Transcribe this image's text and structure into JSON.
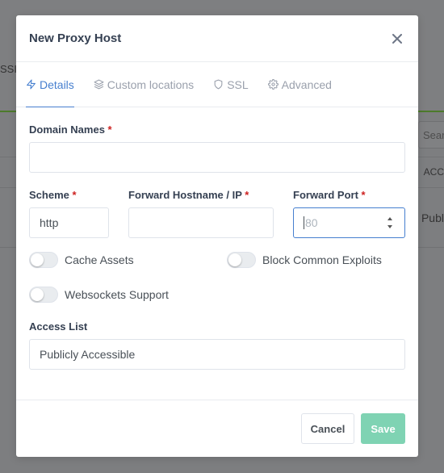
{
  "background": {
    "left_fragment": "SSI",
    "search_fragment": "Searc",
    "col_fragment": "ACC",
    "cell_fragment": "Publ"
  },
  "modal": {
    "title": "New Proxy Host",
    "close_icon": "close-icon"
  },
  "tabs": [
    {
      "label": "Details",
      "icon": "bolt-icon",
      "active": true
    },
    {
      "label": "Custom locations",
      "icon": "layers-icon",
      "active": false
    },
    {
      "label": "SSL",
      "icon": "shield-icon",
      "active": false
    },
    {
      "label": "Advanced",
      "icon": "gear-icon",
      "active": false
    }
  ],
  "form": {
    "domain_names": {
      "label": "Domain Names",
      "required_mark": "*",
      "value": ""
    },
    "scheme": {
      "label": "Scheme",
      "required_mark": "*",
      "value": "http"
    },
    "forward_hostname": {
      "label": "Forward Hostname / IP",
      "required_mark": "*",
      "value": ""
    },
    "forward_port": {
      "label": "Forward Port",
      "required_mark": "*",
      "placeholder": "80",
      "value": ""
    },
    "toggles": {
      "cache_assets": "Cache Assets",
      "block_exploits": "Block Common Exploits",
      "websockets": "Websockets Support"
    },
    "access_list": {
      "label": "Access List",
      "value": "Publicly Accessible"
    }
  },
  "footer": {
    "cancel_label": "Cancel",
    "save_label": "Save"
  },
  "colors": {
    "accent": "#467fcf",
    "save": "#7fd3b3",
    "required": "#cd201f"
  }
}
